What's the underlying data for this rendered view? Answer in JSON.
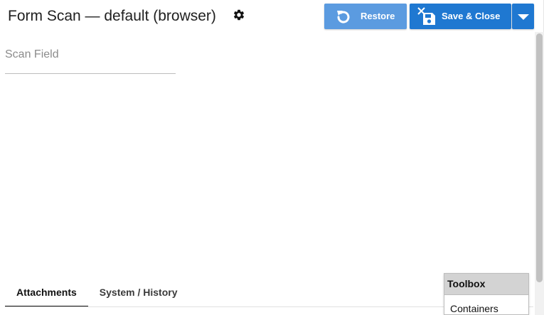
{
  "header": {
    "title": "Form Scan — default (browser)",
    "settings_icon": "gear-icon"
  },
  "actions": {
    "restore": {
      "label": "Restore",
      "icon": "undo-icon",
      "color": "#5b9be0"
    },
    "save_close": {
      "label": "Save & Close",
      "icon": "save-close-icon",
      "color": "#1f78d1"
    },
    "more": {
      "icon": "caret-down-icon"
    }
  },
  "form": {
    "scan_field": {
      "placeholder": "Scan Field",
      "value": ""
    }
  },
  "tabs": [
    {
      "label": "Attachments",
      "active": true
    },
    {
      "label": "System / History",
      "active": false
    }
  ],
  "toolbox": {
    "title": "Toolbox",
    "items": [
      {
        "label": "Containers"
      }
    ]
  }
}
